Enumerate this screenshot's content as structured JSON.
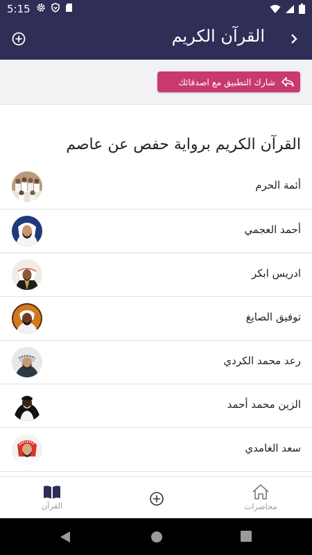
{
  "status_bar": {
    "time": "5:15",
    "icons_left": [
      "gear-icon",
      "shield-icon",
      "sd-card-icon"
    ],
    "icons_right": [
      "wifi-icon",
      "signal-icon",
      "battery-icon"
    ]
  },
  "app_bar": {
    "title": "القرآن الكريم",
    "back_icon": "chevron-right-icon",
    "add_icon": "circle-plus-icon"
  },
  "share": {
    "label": "شارك التطبيق مع اصدقائك",
    "icon": "reply-arrow-icon",
    "color": "#c8396f"
  },
  "section_title": "القرآن الكريم برواية حفص عن عاصم",
  "reciters": [
    {
      "name": "أئمة الحرم"
    },
    {
      "name": "أحمد العجمي"
    },
    {
      "name": "ادريس ابكر"
    },
    {
      "name": "توفيق الصايغ"
    },
    {
      "name": "رعد محمد الكردي"
    },
    {
      "name": "الزين محمد أحمد"
    },
    {
      "name": "سعد الغامدي"
    }
  ],
  "bottom_nav": {
    "quran_label": "القرآن",
    "lectures_label": "محاضرات",
    "add_icon": "circle-plus-icon"
  },
  "colors": {
    "primary": "#2e2e57",
    "accent": "#c8396f"
  }
}
